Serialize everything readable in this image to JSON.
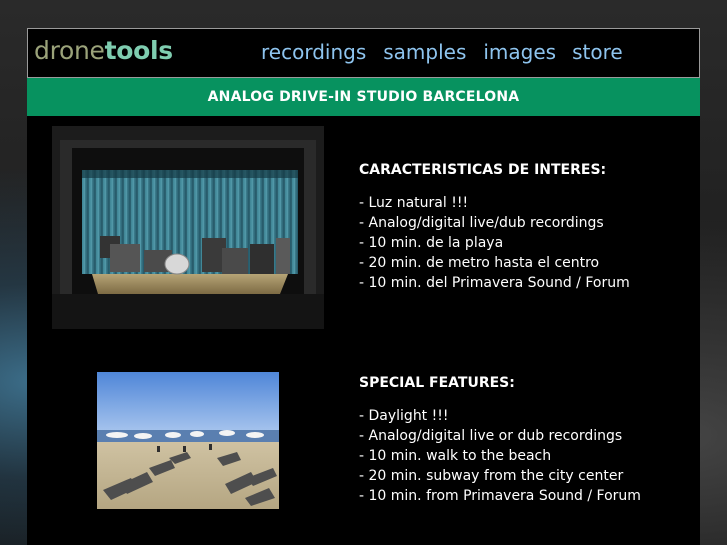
{
  "header": {
    "logo_part1": "drone",
    "logo_part2": "tools",
    "nav": [
      "recordings",
      "samples",
      "images",
      "store"
    ]
  },
  "banner": "ANALOG DRIVE-IN STUDIO BARCELONA",
  "section_es": {
    "title": "CARACTERISTICAS DE INTERES:",
    "items": [
      "- Luz natural !!!",
      "- Analog/digital live/dub recordings",
      "- 10 min. de la playa",
      "- 20 min. de metro hasta el centro",
      "- 10 min. del Primavera Sound / Forum"
    ]
  },
  "section_en": {
    "title": "SPECIAL FEATURES:",
    "items": [
      "- Daylight !!!",
      "- Analog/digital live or dub recordings",
      "- 10 min. walk to the beach",
      "- 20 min. subway from the city center",
      "- 10 min. from Primavera Sound / Forum"
    ]
  },
  "colors": {
    "banner": "#07925f",
    "nav_link": "#8ec4ee",
    "logo_light": "#9ba37a",
    "logo_bold": "#7fcdb0"
  }
}
